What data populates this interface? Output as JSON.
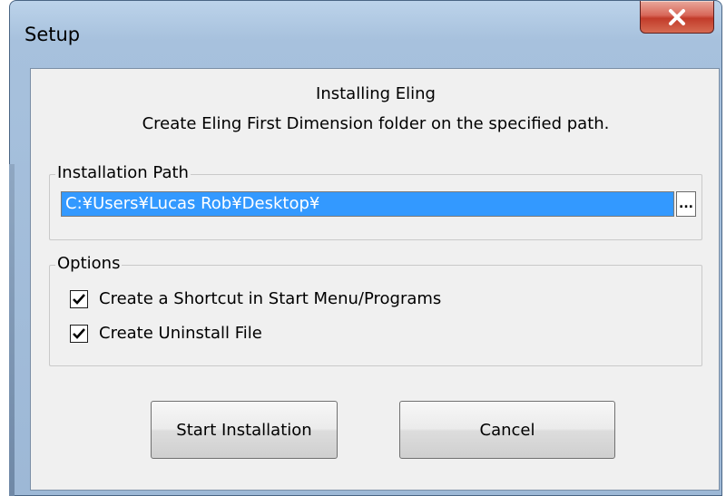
{
  "window": {
    "title": "Setup"
  },
  "header": {
    "line1": "Installing Eling",
    "line2": "Create Eling First Dimension folder on the specified path."
  },
  "installation_path": {
    "label": "Installation Path",
    "value": "C:¥Users¥Lucas Rob¥Desktop¥",
    "browse_label": "..."
  },
  "options": {
    "label": "Options",
    "items": [
      {
        "label": "Create a Shortcut in Start Menu/Programs",
        "checked": true
      },
      {
        "label": "Create Uninstall File",
        "checked": true
      }
    ]
  },
  "buttons": {
    "start": "Start Installation",
    "cancel": "Cancel"
  },
  "colors": {
    "selection": "#3399ff",
    "dialog_bg": "#f0f0f0",
    "close_button": "#c23b2a"
  },
  "icons": {
    "close": "close-icon",
    "check": "checkmark-icon"
  }
}
